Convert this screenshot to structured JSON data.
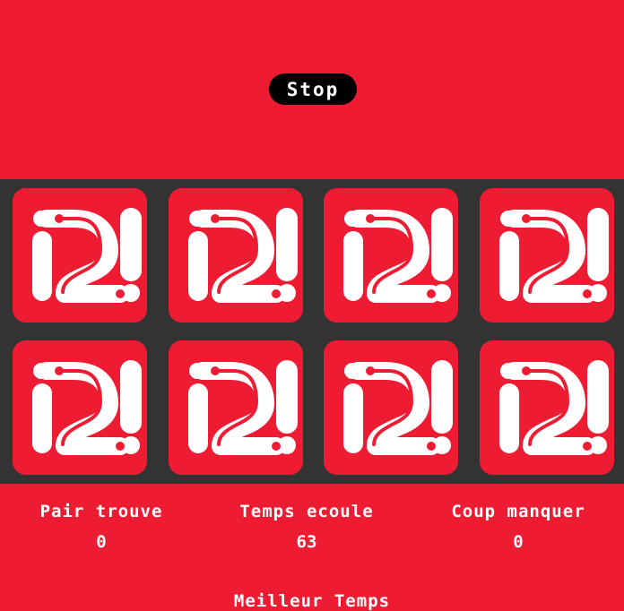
{
  "controls": {
    "stop_label": "Stop"
  },
  "board": {
    "card_logo_text": "i2!",
    "cards": [
      {
        "state": "face-down"
      },
      {
        "state": "face-down"
      },
      {
        "state": "face-down"
      },
      {
        "state": "face-down"
      },
      {
        "state": "face-down"
      },
      {
        "state": "face-down"
      },
      {
        "state": "face-down"
      },
      {
        "state": "face-down"
      }
    ]
  },
  "stats": {
    "pairs_label": "Pair trouve",
    "pairs_value": "0",
    "time_label": "Temps ecoule",
    "time_value": "63",
    "misses_label": "Coup manquer",
    "misses_value": "0",
    "best_time_label": "Meilleur Temps"
  },
  "colors": {
    "brand_red": "#ee1c33",
    "board_bg": "#333333",
    "button_bg": "#000000"
  }
}
